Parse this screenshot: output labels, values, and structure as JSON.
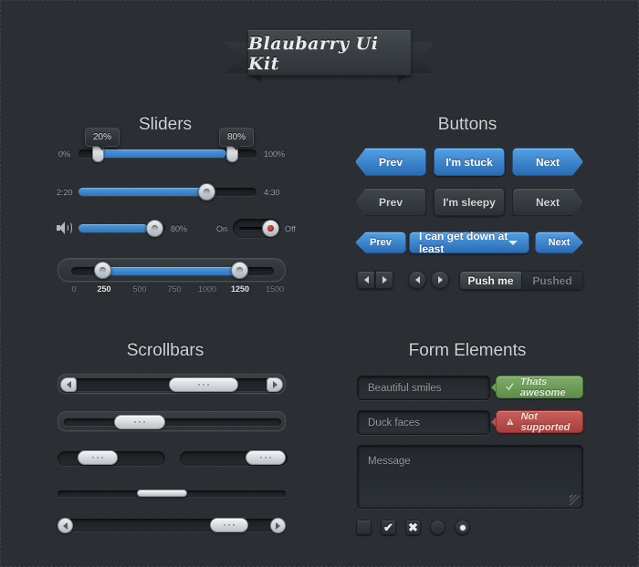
{
  "header": {
    "ribbon_title": "Blaubarry Ui Kit"
  },
  "sections": {
    "sliders": "Sliders",
    "buttons": "Buttons",
    "scrollbars": "Scrollbars",
    "form_elements": "Form Elements"
  },
  "sliders": {
    "percent_slider": {
      "min_label": "0%",
      "max_label": "100%",
      "tooltip_low": "20%",
      "tooltip_high": "80%",
      "low_value": 20,
      "high_value": 80
    },
    "time_slider": {
      "min_label": "2:20",
      "max_label": "4:30",
      "value": 73
    },
    "volume_slider": {
      "icon": "speaker-icon",
      "value_label": "80%",
      "value": 80
    },
    "toggle": {
      "on_label": "On",
      "off_label": "Off",
      "state": "off",
      "led_color": "#c43b32"
    },
    "range_slider": {
      "scale": [
        "0",
        "250",
        "500",
        "750",
        "1000",
        "1250",
        "1500"
      ],
      "active_scale": [
        "250",
        "1250"
      ],
      "low_value": 250,
      "high_value": 1250,
      "min": 0,
      "max": 1500
    }
  },
  "buttons": {
    "accent_blue": "#3d86d0",
    "row1": [
      {
        "label": "Prev",
        "style": "blue",
        "shape": "arrow-left"
      },
      {
        "label": "I'm stuck",
        "style": "blue",
        "shape": "middle"
      },
      {
        "label": "Next",
        "style": "blue",
        "shape": "arrow-right"
      }
    ],
    "row2": [
      {
        "label": "Prev",
        "style": "grey",
        "shape": "arrow-left"
      },
      {
        "label": "I'm sleepy",
        "style": "grey",
        "shape": "middle"
      },
      {
        "label": "Next",
        "style": "grey",
        "shape": "arrow-right"
      }
    ],
    "row3": {
      "prev": "Prev",
      "dropdown": "I can get down at least",
      "dropdown_icon": "chevron-down-icon",
      "next": "Next"
    },
    "row4": {
      "pair_left_icon": "arrow-left-icon",
      "pair_right_icon": "arrow-right-icon",
      "circle_left_icon": "arrow-left-icon",
      "circle_right_icon": "arrow-right-icon",
      "segment_active": "Push me",
      "segment_inactive": "Pushed"
    }
  },
  "scrollbars": {
    "bar1": {
      "left_arrow": "arrow-left-icon",
      "right_arrow": "arrow-right-icon",
      "thumb_grip": "grip-dots"
    },
    "bar2": {
      "thumb_grip": "grip-dots"
    },
    "bar3_left": {
      "thumb_grip": "grip-dots"
    },
    "bar3_right": {
      "thumb_grip": "grip-dots"
    },
    "bar4": {
      "style": "thin"
    },
    "bar5": {
      "left_arrow": "arrow-left-icon",
      "right_arrow": "arrow-right-icon",
      "thumb_grip": "grip-dots"
    }
  },
  "form": {
    "input1_value": "Beautiful smiles",
    "input2_value": "Duck faces",
    "textarea_placeholder": "Message",
    "callout_success": {
      "text": "Thats awesome",
      "icon": "check-icon",
      "color": "#6b9c56"
    },
    "callout_error": {
      "text": "Not supported",
      "icon": "warning-triangle-icon",
      "color": "#b84e4b"
    },
    "checkbox_empty": "",
    "checkbox_checked": "✔",
    "checkbox_crossed": "✖",
    "radio_empty": "",
    "radio_selected": "selected"
  }
}
